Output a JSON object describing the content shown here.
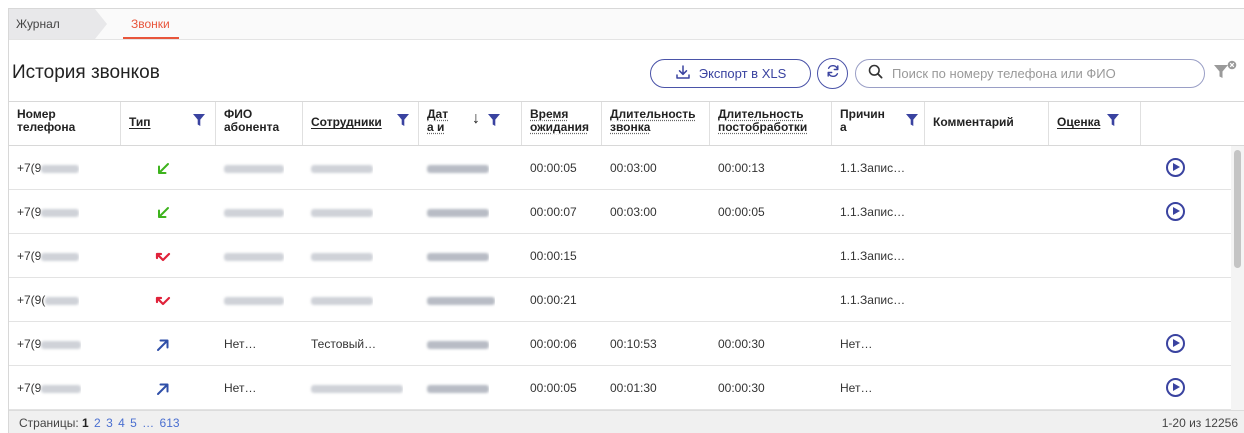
{
  "breadcrumb": {
    "items": [
      "Журнал",
      "Звонки"
    ]
  },
  "page": {
    "title": "История звонков"
  },
  "toolbar": {
    "export_label": "Экспорт в XLS",
    "search_placeholder": "Поиск по номеру телефона или ФИО"
  },
  "table": {
    "columns": {
      "phone": "Номер телефона",
      "type": "Тип",
      "fio": "ФИО абонента",
      "employees": "Сотрудники",
      "date": "Дат а и",
      "wait": "Время ожидания",
      "duration": "Длительность звонка",
      "post": "Длительность постобработки",
      "reason": "Причин а",
      "comment": "Комментарий",
      "rating": "Оценка"
    },
    "rows": [
      {
        "phone": "+7(9",
        "type": "incoming",
        "fio": "",
        "employee": "",
        "date": "",
        "wait": "00:00:05",
        "duration": "00:03:00",
        "post": "00:00:13",
        "reason": "1.1.Запис…",
        "play": true
      },
      {
        "phone": "+7(9",
        "type": "incoming",
        "fio": "",
        "employee": "",
        "date": "",
        "wait": "00:00:07",
        "duration": "00:03:00",
        "post": "00:00:05",
        "reason": "1.1.Запис…",
        "play": true
      },
      {
        "phone": "+7(9",
        "type": "missed",
        "fio": "",
        "employee": "",
        "date": "",
        "wait": "00:00:15",
        "duration": "",
        "post": "",
        "reason": "1.1.Запис…",
        "play": false
      },
      {
        "phone": "+7(9(",
        "type": "missed",
        "fio": "",
        "employee": "",
        "date": "",
        "wait": "00:00:21",
        "duration": "",
        "post": "",
        "reason": "1.1.Запис…",
        "play": false
      },
      {
        "phone": "+7(9",
        "type": "outgoing",
        "fio": "Нет…",
        "employee": "Тестовый…",
        "date": "",
        "wait": "00:00:06",
        "duration": "00:10:53",
        "post": "00:00:30",
        "reason": "Нет…",
        "play": true
      },
      {
        "phone": "+7(9",
        "type": "outgoing",
        "fio": "Нет…",
        "employee": "",
        "date": "",
        "wait": "00:00:05",
        "duration": "00:01:30",
        "post": "00:00:30",
        "reason": "Нет…",
        "play": true
      }
    ]
  },
  "pagination": {
    "label": "Страницы:",
    "current": "1",
    "pages": [
      "2",
      "3",
      "4",
      "5",
      "…",
      "613"
    ],
    "total": "1-20 из 12256"
  },
  "colors": {
    "accent": "#3a43a0",
    "breadcrumb_active": "#e8553b",
    "incoming": "#3db31d",
    "missed": "#e0223a",
    "outgoing": "#2f4fa8"
  }
}
